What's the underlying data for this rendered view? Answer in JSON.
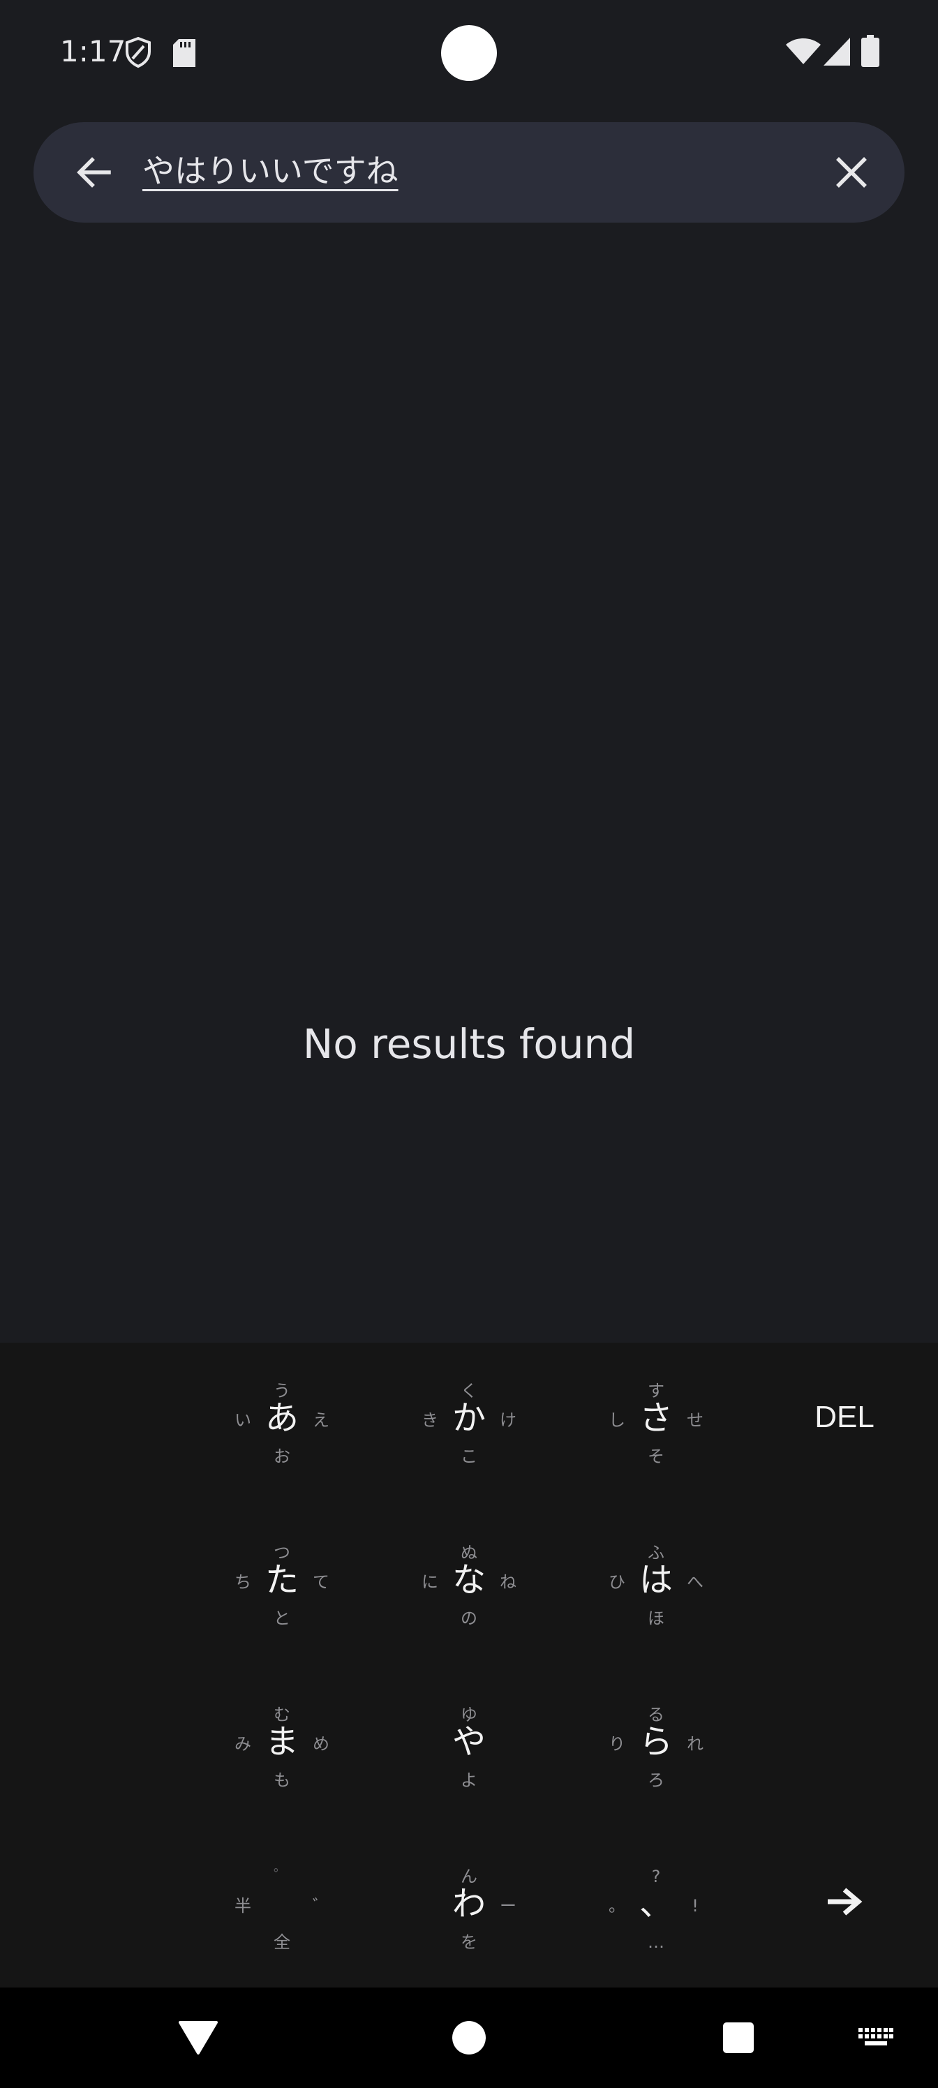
{
  "status_bar": {
    "time": "1:17",
    "icons": [
      "shield-icon",
      "sd-card-icon",
      "wifi-icon",
      "signal-icon",
      "battery-icon"
    ]
  },
  "search": {
    "query": "やはりいいですね",
    "back_icon": "arrow-left-icon",
    "clear_icon": "close-icon"
  },
  "results": {
    "empty_message": "No results found"
  },
  "keyboard": {
    "rows": [
      [
        {
          "main": "あ",
          "up": "う",
          "left": "い",
          "right": "え",
          "down": "お"
        },
        {
          "main": "か",
          "up": "く",
          "left": "き",
          "right": "け",
          "down": "こ"
        },
        {
          "main": "さ",
          "up": "す",
          "left": "し",
          "right": "せ",
          "down": "そ"
        }
      ],
      [
        {
          "main": "た",
          "up": "つ",
          "left": "ち",
          "right": "て",
          "down": "と"
        },
        {
          "main": "な",
          "up": "ぬ",
          "left": "に",
          "right": "ね",
          "down": "の"
        },
        {
          "main": "は",
          "up": "ふ",
          "left": "ひ",
          "right": "へ",
          "down": "ほ"
        }
      ],
      [
        {
          "main": "ま",
          "up": "む",
          "left": "み",
          "right": "め",
          "down": "も"
        },
        {
          "main": "や",
          "up": "ゆ",
          "left": "",
          "right": "",
          "down": "よ"
        },
        {
          "main": "ら",
          "up": "る",
          "left": "り",
          "right": "れ",
          "down": "ろ"
        }
      ],
      [
        {
          "main": "",
          "up": "゜",
          "left": "半",
          "right": "゛",
          "down": "全"
        },
        {
          "main": "わ",
          "up": "ん",
          "left": "",
          "right": "ー",
          "down": "を"
        },
        {
          "main": "、",
          "up": "?",
          "left": "。",
          "right": "!",
          "down": "…"
        }
      ]
    ],
    "del_label": "DEL",
    "enter_icon": "arrow-right-icon"
  },
  "nav_bar": {
    "icons": [
      "back-triangle-icon",
      "home-circle-icon",
      "recents-square-icon",
      "keyboard-switch-icon"
    ]
  }
}
